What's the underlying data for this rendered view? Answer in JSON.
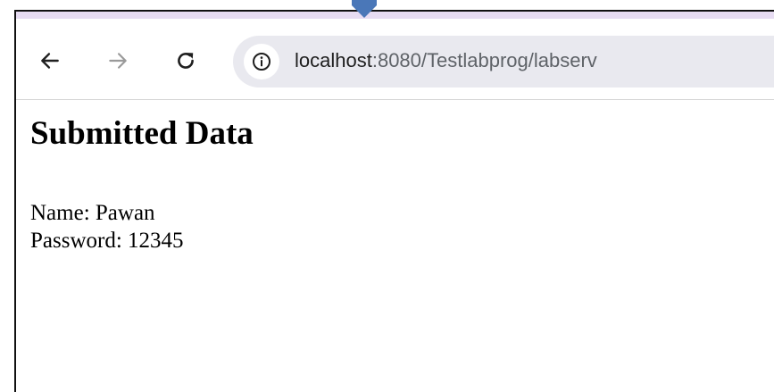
{
  "browser": {
    "url_host": "localhost",
    "url_rest": ":8080/Testlabprog/labserv",
    "colors": {
      "tab_strip": "#e7dcf2",
      "omnibox": "#e9e9ef",
      "pointer_arrow": "#4a77b8"
    },
    "icons": [
      "back-arrow-icon",
      "forward-arrow-icon",
      "reload-icon",
      "info-icon",
      "pointer-arrow-icon"
    ]
  },
  "page": {
    "heading": "Submitted Data",
    "name_label": "Name:",
    "name_value": "Pawan",
    "password_label": "Password:",
    "password_value": "12345"
  }
}
